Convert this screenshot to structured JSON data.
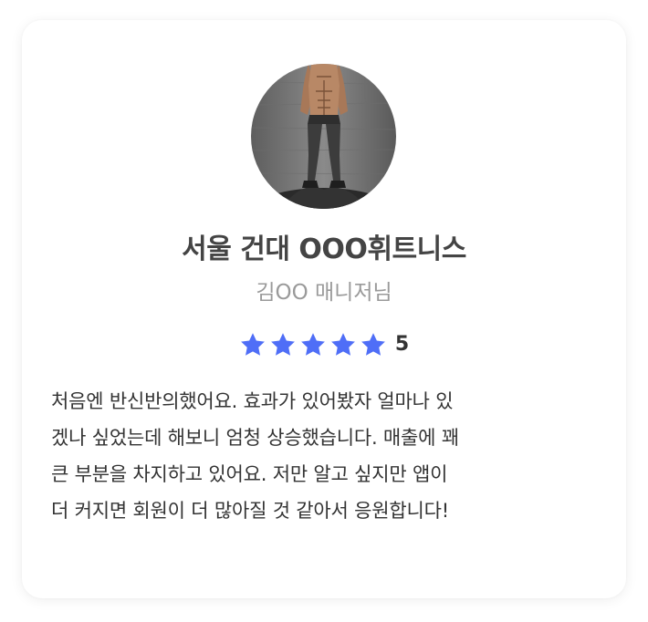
{
  "card": {
    "title": "서울 건대 OOO휘트니스",
    "subtitle": "김OO 매니저님",
    "rating": {
      "value": "5",
      "stars": 5,
      "star_color": "#4f6ef7"
    },
    "review_lines": [
      "처음엔 반신반의했어요. 효과가 있어봤자 얼마나 있",
      "겠나 싶었는데 해보니 엄청 상승했습니다. 매출에 꽤",
      "큰 부분을 차지하고 있어요. 저만 알고 싶지만 앱이",
      "더 커지면 회원이 더 많아질 것 같아서 응원합니다!"
    ]
  }
}
